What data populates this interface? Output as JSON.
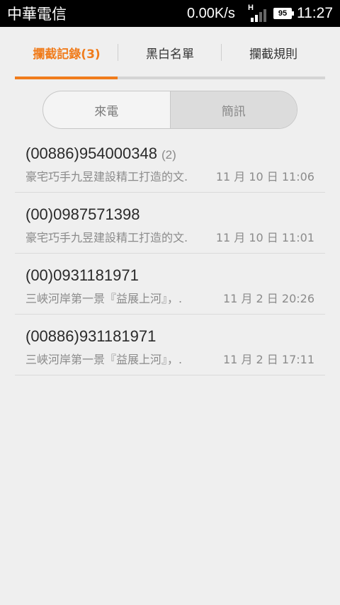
{
  "status_bar": {
    "carrier": "中華電信",
    "network_speed": "0.00K/s",
    "network_type": "H",
    "battery": "95",
    "time": "11:27"
  },
  "tabs": [
    {
      "label": "攔截記錄(3)",
      "active": true
    },
    {
      "label": "黑白名單",
      "active": false
    },
    {
      "label": "攔截規則",
      "active": false
    }
  ],
  "segment": {
    "options": [
      "來電",
      "簡訊"
    ],
    "selected": "簡訊"
  },
  "messages": [
    {
      "phone": "(00886)954000348",
      "count": "(2)",
      "preview": "豪宅巧手九昱建設精工打造的文.",
      "time": "11 月 10 日 11:06"
    },
    {
      "phone": "(00)0987571398",
      "count": "",
      "preview": "豪宅巧手九昱建設精工打造的文.",
      "time": "11 月 10 日 11:01"
    },
    {
      "phone": "(00)0931181971",
      "count": "",
      "preview": "三峽河岸第一景『益展上河』，.",
      "time": "11 月 2 日 20:26"
    },
    {
      "phone": "(00886)931181971",
      "count": "",
      "preview": "三峽河岸第一景『益展上河』，.",
      "time": "11 月 2 日 17:11"
    }
  ],
  "colors": {
    "accent": "#f07c1c",
    "background": "#efefef"
  }
}
